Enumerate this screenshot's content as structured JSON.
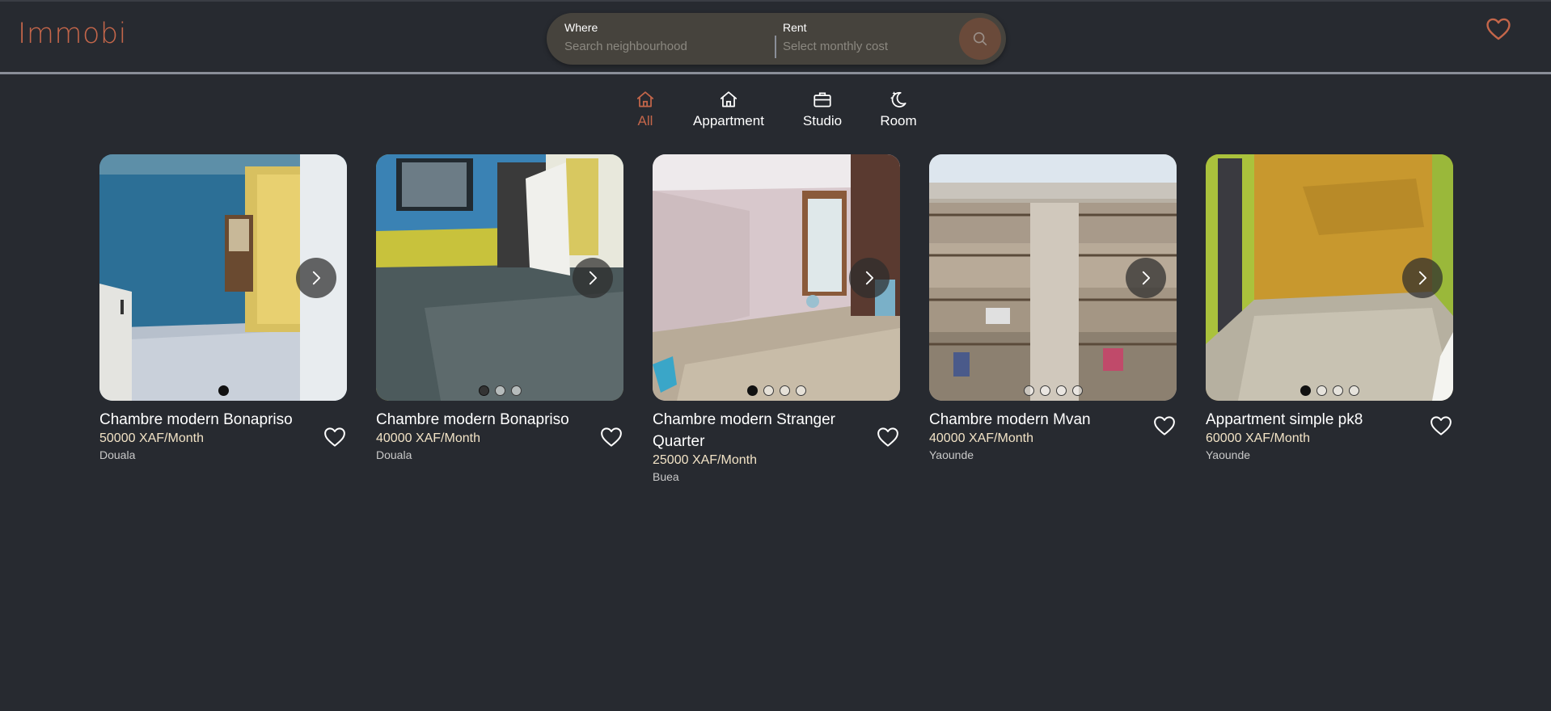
{
  "app": {
    "logo": "Immobi"
  },
  "search": {
    "where_label": "Where",
    "where_placeholder": "Search neighbourhood",
    "rent_label": "Rent",
    "rent_placeholder": "Select monthly cost",
    "button_icon": "search-icon"
  },
  "header": {
    "favorites_icon": "heart-icon"
  },
  "categories": [
    {
      "label": "All",
      "icon": "home-icon",
      "active": true
    },
    {
      "label": "Appartment",
      "icon": "home-icon",
      "active": false
    },
    {
      "label": "Studio",
      "icon": "briefcase-icon",
      "active": false
    },
    {
      "label": "Room",
      "icon": "moon-stars-icon",
      "active": false
    }
  ],
  "colors": {
    "accent": "#c4664a",
    "background": "#272a30",
    "price": "#f2e3c6"
  },
  "listings": [
    {
      "title": "Chambre modern Bonapriso",
      "price": "50000 XAF/Month",
      "city": "Douala",
      "image_count": 1,
      "active_image": 1
    },
    {
      "title": "Chambre modern Bonapriso",
      "price": "40000 XAF/Month",
      "city": "Douala",
      "image_count": 3,
      "active_image": 1
    },
    {
      "title": "Chambre modern Stranger Quarter",
      "price": "25000 XAF/Month",
      "city": "Buea",
      "image_count": 4,
      "active_image": 1
    },
    {
      "title": "Chambre modern Mvan",
      "price": "40000 XAF/Month",
      "city": "Yaounde",
      "image_count": 4,
      "active_image": 0
    },
    {
      "title": "Appartment simple pk8",
      "price": "60000 XAF/Month",
      "city": "Yaounde",
      "image_count": 4,
      "active_image": 1
    }
  ]
}
